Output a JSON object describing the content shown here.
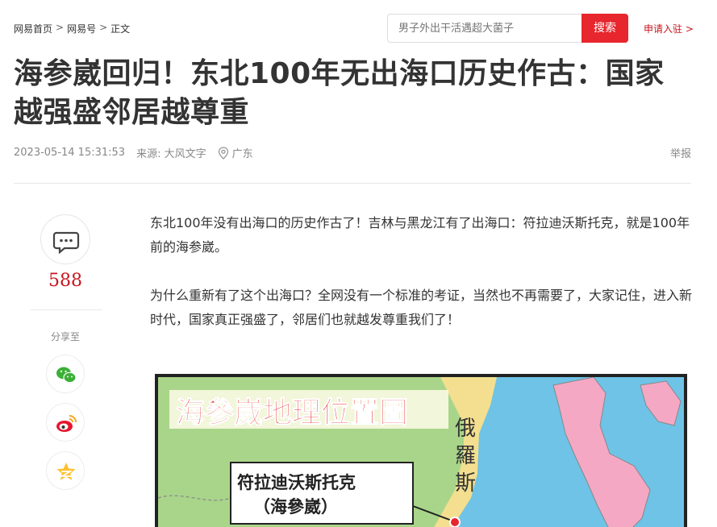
{
  "breadcrumb": {
    "home": "网易首页",
    "sep1": ">",
    "section": "网易号",
    "sep2": ">",
    "current": "正文"
  },
  "search": {
    "placeholder": "男子外出干活遇超大菌子",
    "button": "搜索"
  },
  "apply": {
    "label": "申请入驻 >"
  },
  "article": {
    "title": "海参崴回归！东北100年无出海口历史作古：国家越强盛邻居越尊重",
    "date": "2023-05-14 15:31:53",
    "source": "来源: 大风文字",
    "location": "广东",
    "report": "举报",
    "paragraphs": [
      "东北100年没有出海口的历史作古了！吉林与黑龙江有了出海口：符拉迪沃斯托克，就是100年前的海参崴。",
      "为什么重新有了这个出海口？全网没有一个标准的考证，当然也不再需要了，大家记住，进入新时代，国家真正强盛了，邻居们也就越发尊重我们了！"
    ]
  },
  "side": {
    "comment_count": "588",
    "share_label": "分享至"
  },
  "map": {
    "title": "海參崴地理位置圖",
    "russia_label": "俄羅斯",
    "city_label_line1": "符拉迪沃斯托克",
    "city_label_line2": "（海參崴）"
  },
  "colors": {
    "accent": "#e7262d",
    "count": "#c9151e",
    "map_land": "#a9d58a",
    "map_sea": "#6ec3e6",
    "map_japan": "#f5a8c4",
    "map_russia": "#f3df8f"
  },
  "icons": [
    "comment-icon",
    "wechat-icon",
    "weibo-icon",
    "qzone-icon",
    "location-pin-icon"
  ]
}
